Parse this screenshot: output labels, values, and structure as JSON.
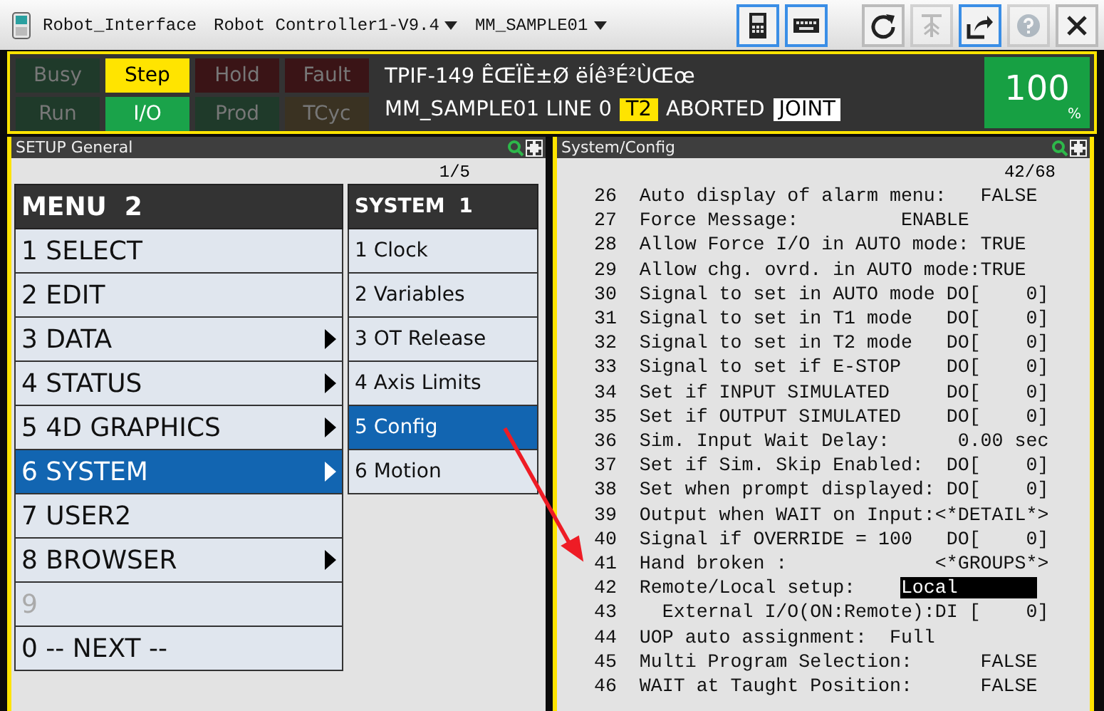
{
  "title_bar": {
    "app_name": "Robot_Interface",
    "dropdowns": [
      {
        "label": "Robot Controller1-V9.4"
      },
      {
        "label": "MM_SAMPLE01"
      }
    ],
    "tools": [
      {
        "kind": "pendant",
        "selected": true,
        "disabled": false
      },
      {
        "kind": "keyboard",
        "selected": true,
        "disabled": false
      },
      {
        "kind": "refresh",
        "selected": false,
        "disabled": false
      },
      {
        "kind": "lift",
        "selected": false,
        "disabled": true
      },
      {
        "kind": "popout",
        "selected": true,
        "disabled": false
      },
      {
        "kind": "help",
        "selected": false,
        "disabled": true
      },
      {
        "kind": "close",
        "selected": false,
        "disabled": false
      }
    ]
  },
  "status_lights": [
    {
      "label": "Busy",
      "on": false,
      "color": "#1f3a2a"
    },
    {
      "label": "Step",
      "on": true,
      "color": "#ffe400"
    },
    {
      "label": "Hold",
      "on": false,
      "color": "#3a1416"
    },
    {
      "label": "Fault",
      "on": false,
      "color": "#3a1416"
    },
    {
      "label": "Run",
      "on": false,
      "color": "#1f3a2a"
    },
    {
      "label": "I/O",
      "on": true,
      "color": "#1aa34a"
    },
    {
      "label": "Prod",
      "on": false,
      "color": "#1f3a2a"
    },
    {
      "label": "TCyc",
      "on": false,
      "color": "#3a3222"
    }
  ],
  "message": {
    "line_1": "TPIF-149 ÊŒÏÈ±Ø ëÍê³É²ÙŒœ",
    "program": "MM_SAMPLE01 LINE 0",
    "mode": "T2",
    "state": "ABORTED",
    "coord": "JOINT"
  },
  "override": {
    "value": "100",
    "unit": "%"
  },
  "left_panel": {
    "title": "SETUP General",
    "page": "1/5",
    "menu": {
      "title": "MENU  2",
      "items": [
        {
          "label": "1 SELECT",
          "submenu": false,
          "selected": false,
          "disabled": false
        },
        {
          "label": "2 EDIT",
          "submenu": false,
          "selected": false,
          "disabled": false
        },
        {
          "label": "3 DATA",
          "submenu": true,
          "selected": false,
          "disabled": false
        },
        {
          "label": "4 STATUS",
          "submenu": true,
          "selected": false,
          "disabled": false
        },
        {
          "label": "5 4D GRAPHICS",
          "submenu": true,
          "selected": false,
          "disabled": false
        },
        {
          "label": "6 SYSTEM",
          "submenu": true,
          "selected": true,
          "disabled": false
        },
        {
          "label": "7 USER2",
          "submenu": false,
          "selected": false,
          "disabled": false
        },
        {
          "label": "8 BROWSER",
          "submenu": true,
          "selected": false,
          "disabled": false
        },
        {
          "label": "9",
          "submenu": false,
          "selected": false,
          "disabled": true
        },
        {
          "label": "0 -- NEXT --",
          "submenu": false,
          "selected": false,
          "disabled": false
        }
      ]
    },
    "submenu": {
      "title": "SYSTEM  1",
      "items": [
        {
          "label": "1 Clock",
          "selected": false
        },
        {
          "label": "2 Variables",
          "selected": false
        },
        {
          "label": "3 OT Release",
          "selected": false
        },
        {
          "label": "4 Axis Limits",
          "selected": false
        },
        {
          "label": "5 Config",
          "selected": true
        },
        {
          "label": "6 Motion",
          "selected": false
        }
      ]
    }
  },
  "right_panel": {
    "title": "System/Config",
    "page": "42/68",
    "lines": [
      {
        "num": "26",
        "text": "Auto display of alarm menu:   FALSE",
        "selected": false
      },
      {
        "num": "27",
        "text": "Force Message:         ENABLE",
        "selected": false
      },
      {
        "num": "28",
        "text": "Allow Force I/O in AUTO mode: TRUE",
        "selected": false
      },
      {
        "num": "29",
        "text": "Allow chg. ovrd. in AUTO mode:TRUE",
        "selected": false
      },
      {
        "num": "30",
        "text": "Signal to set in AUTO mode DO[    0]",
        "selected": false
      },
      {
        "num": "31",
        "text": "Signal to set in T1 mode   DO[    0]",
        "selected": false
      },
      {
        "num": "32",
        "text": "Signal to set in T2 mode   DO[    0]",
        "selected": false
      },
      {
        "num": "33",
        "text": "Signal to set if E-STOP    DO[    0]",
        "selected": false
      },
      {
        "num": "34",
        "text": "Set if INPUT SIMULATED     DO[    0]",
        "selected": false
      },
      {
        "num": "35",
        "text": "Set if OUTPUT SIMULATED    DO[    0]",
        "selected": false
      },
      {
        "num": "36",
        "text": "Sim. Input Wait Delay:      0.00 sec",
        "selected": false
      },
      {
        "num": "37",
        "text": "Set if Sim. Skip Enabled:  DO[    0]",
        "selected": false
      },
      {
        "num": "38",
        "text": "Set when prompt displayed: DO[    0]",
        "selected": false
      },
      {
        "num": "39",
        "text": "Output when WAIT on Input:<*DETAIL*>",
        "selected": false
      },
      {
        "num": "40",
        "text": "Signal if OVERRIDE = 100   DO[    0]",
        "selected": false
      },
      {
        "num": "41",
        "text": "Hand broken :             <*GROUPS*>",
        "selected": false
      },
      {
        "num": "42",
        "text": "Remote/Local setup:    ",
        "value": "Local",
        "selected": true
      },
      {
        "num": "43",
        "text": "  External I/O(ON:Remote):DI [    0]",
        "selected": false
      },
      {
        "num": "44",
        "text": "UOP auto assignment:  Full",
        "selected": false
      },
      {
        "num": "45",
        "text": "Multi Program Selection:      FALSE",
        "selected": false
      },
      {
        "num": "46",
        "text": "WAIT at Taught Position:      FALSE",
        "selected": false
      }
    ]
  }
}
